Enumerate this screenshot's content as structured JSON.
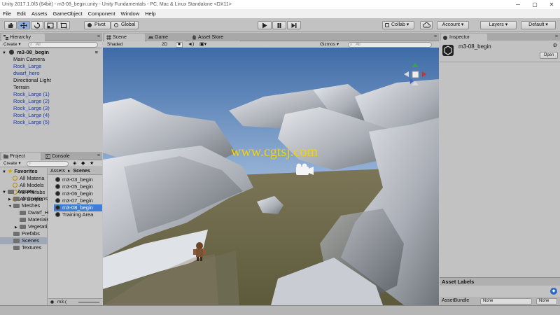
{
  "window": {
    "title": "Unity 2017.1.0f3 (64bit) - m3-08_begin.unity - Unity Fundamentals - PC, Mac & Linux Standalone <DX11>",
    "controls": [
      "─",
      "▢",
      "✕"
    ]
  },
  "menu": [
    "File",
    "Edit",
    "Assets",
    "GameObject",
    "Component",
    "Window",
    "Help"
  ],
  "toolbar": {
    "pivot": "Pivot",
    "global": "Global",
    "collab": "Collab ▾",
    "account": "Account",
    "layers": "Layers",
    "layout": "Default"
  },
  "hierarchy": {
    "tab": "Hierarchy",
    "create": "Create ▾",
    "search_placeholder": "All",
    "scene_name": "m3-08_begin",
    "items": [
      {
        "label": "Main Camera",
        "prefab": false
      },
      {
        "label": "Rock_Large",
        "prefab": true
      },
      {
        "label": "dwarf_hero",
        "prefab": true
      },
      {
        "label": "Directional Light",
        "prefab": false
      },
      {
        "label": "Terrain",
        "prefab": false
      },
      {
        "label": "Rock_Large (1)",
        "prefab": true
      },
      {
        "label": "Rock_Large (2)",
        "prefab": true
      },
      {
        "label": "Rock_Large (3)",
        "prefab": true
      },
      {
        "label": "Rock_Large (4)",
        "prefab": true
      },
      {
        "label": "Rock_Large (5)",
        "prefab": true
      }
    ]
  },
  "scene_tabs": {
    "scene": "Scene",
    "game": "Game",
    "asset_store": "Asset Store",
    "shaded": "Shaded",
    "mode_2d": "2D",
    "gizmos": "Gizmos ▾",
    "search_placeholder": "All"
  },
  "project": {
    "tab": "Project",
    "console_tab": "Console",
    "create": "Create ▾",
    "favorites": {
      "label": "Favorites",
      "items": [
        "All Materia",
        "All Models",
        "All Prefabs",
        "All Scripts"
      ]
    },
    "assets": {
      "label": "Assets",
      "items": [
        {
          "label": "Animations",
          "expandable": true,
          "indent": 1
        },
        {
          "label": "Meshes",
          "expandable": true,
          "indent": 1,
          "expanded": true
        },
        {
          "label": "Dwarf_H",
          "expandable": false,
          "indent": 2
        },
        {
          "label": "Materials",
          "expandable": false,
          "indent": 2
        },
        {
          "label": "Vegetati",
          "expandable": true,
          "indent": 2
        },
        {
          "label": "Prefabs",
          "expandable": false,
          "indent": 1
        },
        {
          "label": "Scenes",
          "expandable": false,
          "indent": 1,
          "selected": true
        },
        {
          "label": "Textures",
          "expandable": false,
          "indent": 1
        }
      ]
    },
    "breadcrumb": [
      "Assets",
      "Scenes"
    ],
    "files": [
      {
        "label": "m3-03_begin",
        "selected": false
      },
      {
        "label": "m3-05_begin",
        "selected": false
      },
      {
        "label": "m3-06_begin",
        "selected": false
      },
      {
        "label": "m3-07_begin",
        "selected": false
      },
      {
        "label": "m3-08_begin",
        "selected": true
      },
      {
        "label": "Training Area",
        "selected": false
      }
    ],
    "footer_path": "m3-("
  },
  "inspector": {
    "tab": "Inspector",
    "object_name": "m3-08_begin",
    "open_button": "Open",
    "asset_labels": "Asset Labels",
    "assetbundle_label": "AssetBundle",
    "assetbundle_value": "None",
    "variant_value": "None"
  },
  "watermark": "www.cgtsj.com",
  "colors": {
    "accent": "#3e7ed8",
    "prefab_text": "#1a3ca8",
    "panel_bg": "#c2c2c2"
  }
}
